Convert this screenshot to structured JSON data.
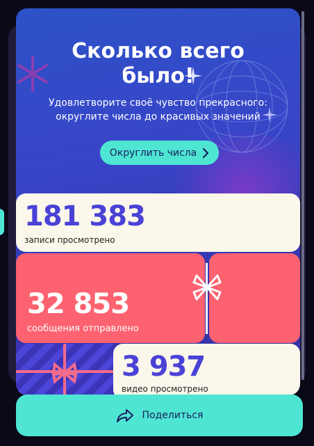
{
  "header": {
    "title_line1": "Сколько всего",
    "title_line2": "было!",
    "subtitle_line1": "Удовлетворите своё чувство прекрасного:",
    "subtitle_line2": "округлите числа до красивых значений"
  },
  "round_button": {
    "label": "Округлить числа",
    "icon": "chevron-right-icon"
  },
  "stats": {
    "records": {
      "value": "181 383",
      "label": "записи просмотрено"
    },
    "messages": {
      "value": "32 853",
      "label": "сообщения отправлено"
    },
    "videos": {
      "value": "3 937",
      "label": "видео просмотрено"
    }
  },
  "share_button": {
    "label": "Поделиться",
    "icon": "share-arrow-icon"
  },
  "colors": {
    "accent": "#4ee6d3",
    "card_blue": "#3845c8",
    "stat_red": "#fd6270",
    "stat_cream": "#fbf7ea",
    "number_purple": "#4a42d6"
  }
}
